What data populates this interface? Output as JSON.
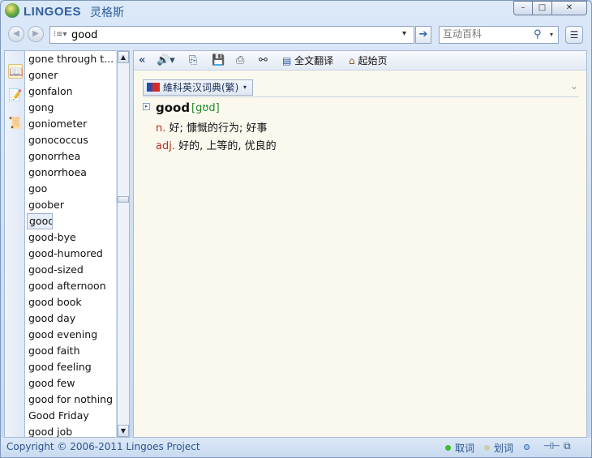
{
  "app": {
    "title": "LINGOES",
    "title_cn": "灵格斯"
  },
  "window_controls": {
    "minimize": "–",
    "maximize": "□",
    "close": "✕"
  },
  "search": {
    "value": "good",
    "dropdown": "▾",
    "go": "➔",
    "list_icon": "⁝≡▾"
  },
  "wiki": {
    "placeholder": "互动百科",
    "dropdown": "▾",
    "search_icon": "⚲"
  },
  "menu_icon": "☰",
  "sidebar": {
    "icons": [
      "book-icon",
      "edit-icon",
      "note-icon"
    ]
  },
  "wordlist": {
    "items": [
      "gone through t...",
      "goner",
      "gonfalon",
      "gong",
      "goniometer",
      "gonococcus",
      "gonorrhea",
      "gonorrhoea",
      "goo",
      "goober",
      "good",
      "good-bye",
      "good-humored",
      "good-sized",
      "good afternoon",
      "good book",
      "good day",
      "good evening",
      "good faith",
      "good feeling",
      "good few",
      "good for nothing",
      "Good Friday",
      "good job"
    ],
    "selected_index": 10
  },
  "scroll": {
    "up": "▲",
    "down": "▼"
  },
  "main_toolbar": {
    "collapse": "«",
    "speaker": "🔊▾",
    "copy": "⎘",
    "save": "💾",
    "print": "⎙",
    "find": "⚯",
    "translate_label": "全文翻译",
    "home_label": "起始页"
  },
  "dictionary": {
    "name": "維科英汉词典(繁)",
    "tab_arrow": "▾",
    "collapse_icon": "⌄"
  },
  "entry": {
    "toggle": "▸",
    "headword": "good",
    "phonetic": "[gʊd]",
    "definitions": [
      {
        "pos": "n.",
        "text": "好; 慷慨的行为; 好事"
      },
      {
        "pos": "adj.",
        "text": "好的, 上等的, 优良的"
      }
    ]
  },
  "status": {
    "copyright": "Copyright © 2006-2011 Lingoes Project",
    "quick_lookup": "取词",
    "select_lookup": "划词",
    "pin": "⊣⊢",
    "mini": "⧉"
  },
  "colors": {
    "accent": "#2c5590",
    "pos": "#c02a20",
    "phonetic": "#1f8a2b",
    "content_bg": "#fbf9ee"
  }
}
